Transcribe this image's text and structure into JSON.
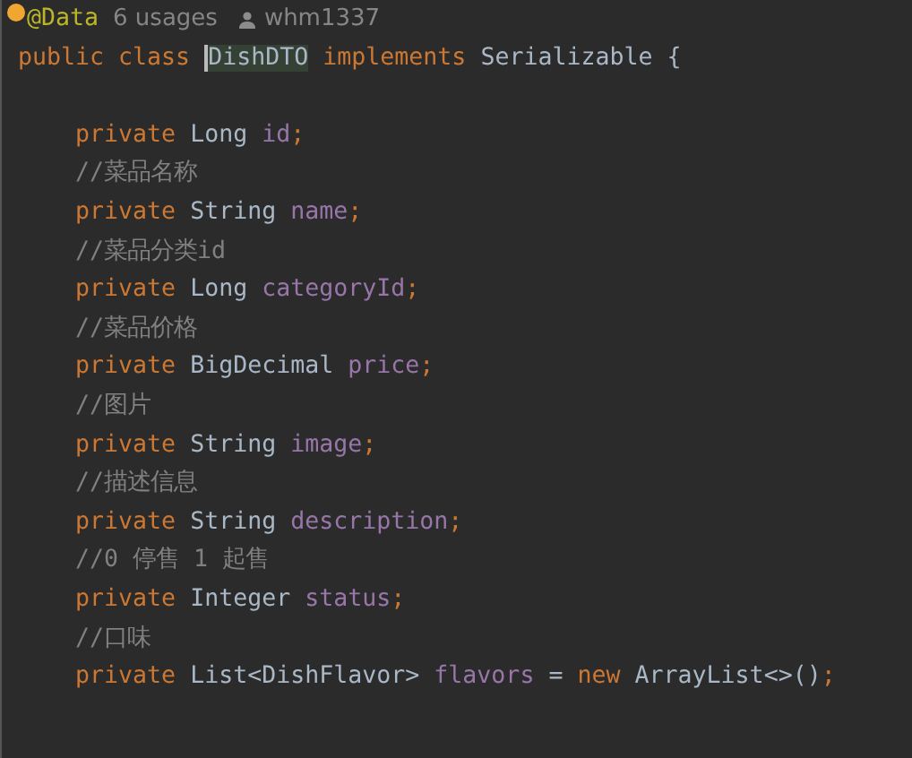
{
  "inlay_header": {
    "annotation": "@Data",
    "usages": "6 usages",
    "author": "whm1337"
  },
  "lines": [
    {
      "tokens": [
        {
          "text": "public class ",
          "kind": "keyword"
        },
        {
          "text": "DishDTO",
          "kind": "type",
          "highlighted": true
        },
        {
          "text": " implements ",
          "kind": "keyword"
        },
        {
          "text": "Serializable {",
          "kind": "type"
        }
      ],
      "children": [
        {
          "kind": "blank"
        },
        {
          "tokens": [
            {
              "text": "private ",
              "kind": "keyword"
            },
            {
              "text": "Long ",
              "kind": "type"
            },
            {
              "text": "id",
              "kind": "field"
            },
            {
              "text": ";",
              "kind": "keyword"
            }
          ]
        },
        {
          "tokens": [
            {
              "text": "//菜品名称",
              "kind": "comment"
            }
          ]
        },
        {
          "tokens": [
            {
              "text": "private ",
              "kind": "keyword"
            },
            {
              "text": "String ",
              "kind": "type"
            },
            {
              "text": "name",
              "kind": "field"
            },
            {
              "text": ";",
              "kind": "keyword"
            }
          ]
        },
        {
          "tokens": [
            {
              "text": "//菜品分类id",
              "kind": "comment"
            }
          ]
        },
        {
          "tokens": [
            {
              "text": "private ",
              "kind": "keyword"
            },
            {
              "text": "Long ",
              "kind": "type"
            },
            {
              "text": "categoryId",
              "kind": "field"
            },
            {
              "text": ";",
              "kind": "keyword"
            }
          ]
        },
        {
          "tokens": [
            {
              "text": "//菜品价格",
              "kind": "comment"
            }
          ]
        },
        {
          "tokens": [
            {
              "text": "private ",
              "kind": "keyword"
            },
            {
              "text": "BigDecimal ",
              "kind": "type"
            },
            {
              "text": "price",
              "kind": "field"
            },
            {
              "text": ";",
              "kind": "keyword"
            }
          ]
        },
        {
          "tokens": [
            {
              "text": "//图片",
              "kind": "comment"
            }
          ]
        },
        {
          "tokens": [
            {
              "text": "private ",
              "kind": "keyword"
            },
            {
              "text": "String ",
              "kind": "type"
            },
            {
              "text": "image",
              "kind": "field"
            },
            {
              "text": ";",
              "kind": "keyword"
            }
          ]
        },
        {
          "tokens": [
            {
              "text": "//描述信息",
              "kind": "comment"
            }
          ]
        },
        {
          "tokens": [
            {
              "text": "private ",
              "kind": "keyword"
            },
            {
              "text": "String ",
              "kind": "type"
            },
            {
              "text": "description",
              "kind": "field"
            },
            {
              "text": ";",
              "kind": "keyword"
            }
          ]
        },
        {
          "tokens": [
            {
              "text": "//0 停售 1 起售",
              "kind": "comment"
            }
          ]
        },
        {
          "tokens": [
            {
              "text": "private ",
              "kind": "keyword"
            },
            {
              "text": "Integer ",
              "kind": "type"
            },
            {
              "text": "status",
              "kind": "field"
            },
            {
              "text": ";",
              "kind": "keyword"
            }
          ]
        },
        {
          "tokens": [
            {
              "text": "//口味",
              "kind": "comment"
            }
          ]
        },
        {
          "tokens": [
            {
              "text": "private ",
              "kind": "keyword"
            },
            {
              "text": "List<DishFlavor> ",
              "kind": "type"
            },
            {
              "text": "flavors",
              "kind": "field"
            },
            {
              "text": " = ",
              "kind": "type"
            },
            {
              "text": "new ",
              "kind": "keyword"
            },
            {
              "text": "ArrayList<>()",
              "kind": "type"
            },
            {
              "text": ";",
              "kind": "keyword"
            }
          ]
        }
      ]
    }
  ]
}
